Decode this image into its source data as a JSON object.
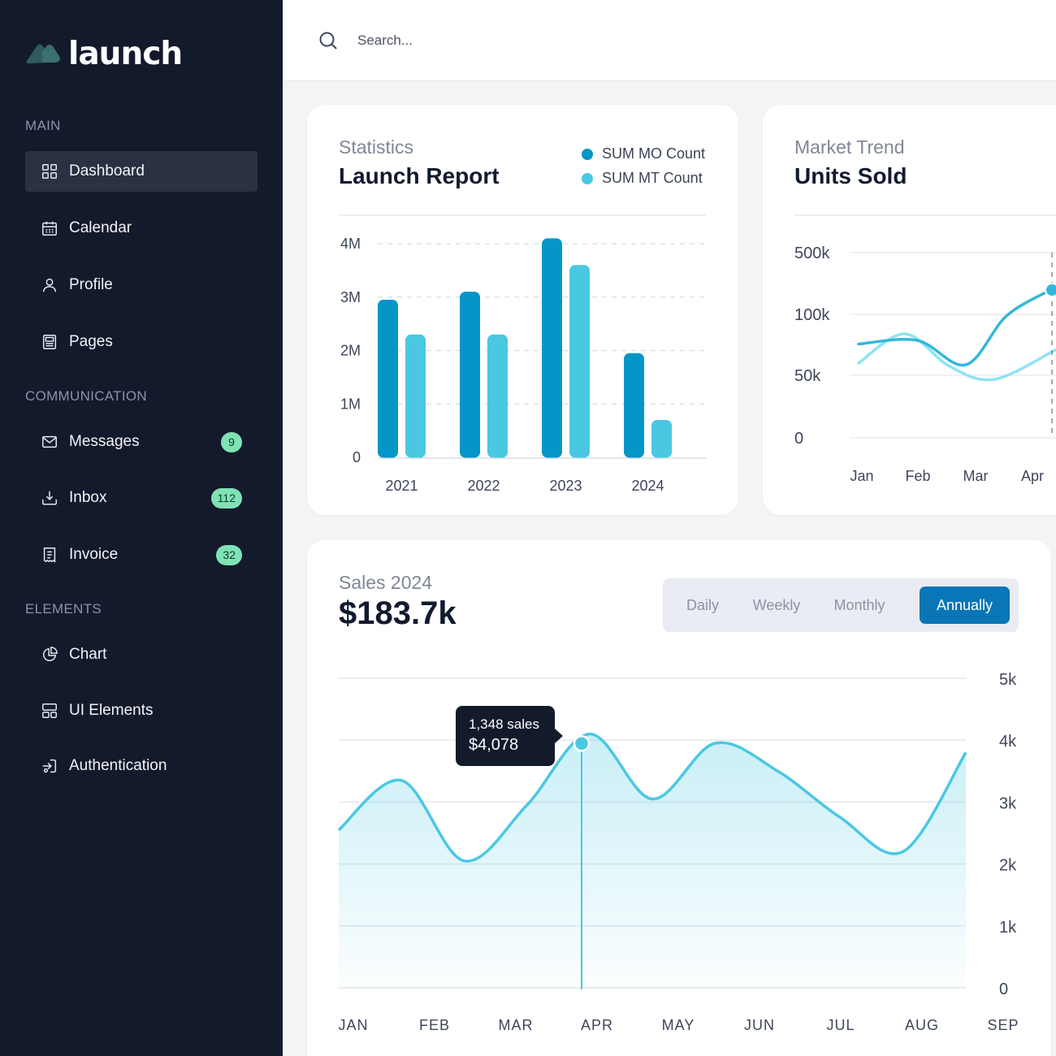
{
  "app": {
    "name": "launch"
  },
  "sidebar": {
    "sections": [
      {
        "label": "MAIN"
      },
      {
        "label": "COMMUNICATION"
      },
      {
        "label": "ELEMENTS"
      }
    ],
    "items": [
      {
        "label": "Dashboard",
        "icon": "grid-icon",
        "active": true
      },
      {
        "label": "Calendar",
        "icon": "calendar-icon"
      },
      {
        "label": "Profile",
        "icon": "user-icon"
      },
      {
        "label": "Pages",
        "icon": "document-icon"
      },
      {
        "label": "Messages",
        "icon": "envelope-icon",
        "badge": "9"
      },
      {
        "label": "Inbox",
        "icon": "inbox-download-icon",
        "badge": "112"
      },
      {
        "label": "Invoice",
        "icon": "invoice-icon",
        "badge": "32"
      },
      {
        "label": "Chart",
        "icon": "pie-chart-icon"
      },
      {
        "label": "UI Elements",
        "icon": "layout-icon"
      },
      {
        "label": "Authentication",
        "icon": "login-icon"
      }
    ]
  },
  "search": {
    "placeholder": "Search..."
  },
  "colors": {
    "sidebar_bg": "#131a2c",
    "primary": "#0596c8",
    "secondary": "#4ac8e2",
    "accent_button": "#0876b7",
    "badge": "#7fe3b4"
  },
  "launch_report": {
    "subtitle": "Statistics",
    "title": "Launch Report",
    "chart_data": {
      "type": "bar",
      "categories": [
        "2021",
        "2022",
        "2023",
        "2024"
      ],
      "series": [
        {
          "name": "SUM MO Count",
          "color": "#0596c8",
          "values": [
            2.95,
            3.1,
            4.1,
            1.95
          ]
        },
        {
          "name": "SUM MT Count",
          "color": "#4ac8e2",
          "values": [
            2.3,
            2.3,
            3.6,
            0.7
          ]
        }
      ],
      "yticks": [
        "0",
        "1M",
        "2M",
        "3M",
        "4M"
      ],
      "yvalues": [
        0,
        1,
        2,
        3,
        4
      ],
      "ylim": [
        0,
        4
      ],
      "grid": true,
      "legend": "top-right"
    }
  },
  "market_trend": {
    "subtitle": "Market Trend",
    "title": "Units Sold",
    "chart_data": {
      "type": "line",
      "x": [
        "Jan",
        "Feb",
        "Mar",
        "Apr"
      ],
      "yticks": [
        "0",
        "50k",
        "100k",
        "500k"
      ],
      "scale": "categorical-ticks",
      "series": [
        {
          "color": "#34b8d9",
          "values": [
            85000,
            65000,
            58000,
            350000
          ]
        },
        {
          "color": "#8ee3f4",
          "values": [
            58000,
            78000,
            48000,
            75000
          ]
        }
      ],
      "grid": true
    }
  },
  "sales": {
    "subtitle": "Sales 2024",
    "total": "$183.7k",
    "periods": [
      {
        "label": "Daily"
      },
      {
        "label": "Weekly"
      },
      {
        "label": "Monthly"
      },
      {
        "label": "Annually",
        "active": true
      }
    ],
    "tooltip": {
      "sales": "1,348 sales",
      "value": "$4,078"
    },
    "chart_data": {
      "type": "area",
      "x": [
        "JAN",
        "FEB",
        "MAR",
        "APR",
        "MAY",
        "JUN",
        "JUL",
        "AUG",
        "SEP"
      ],
      "yticks": [
        "0",
        "1k",
        "2k",
        "3k",
        "4k",
        "5k"
      ],
      "ylim": [
        0,
        5000
      ],
      "values": [
        2550,
        3350,
        2050,
        2950,
        4100,
        3050,
        3950,
        3500,
        2750,
        2200,
        3800
      ],
      "highlight": {
        "x": "APR",
        "value": 4078,
        "sales": 1348
      },
      "grid": true
    }
  }
}
